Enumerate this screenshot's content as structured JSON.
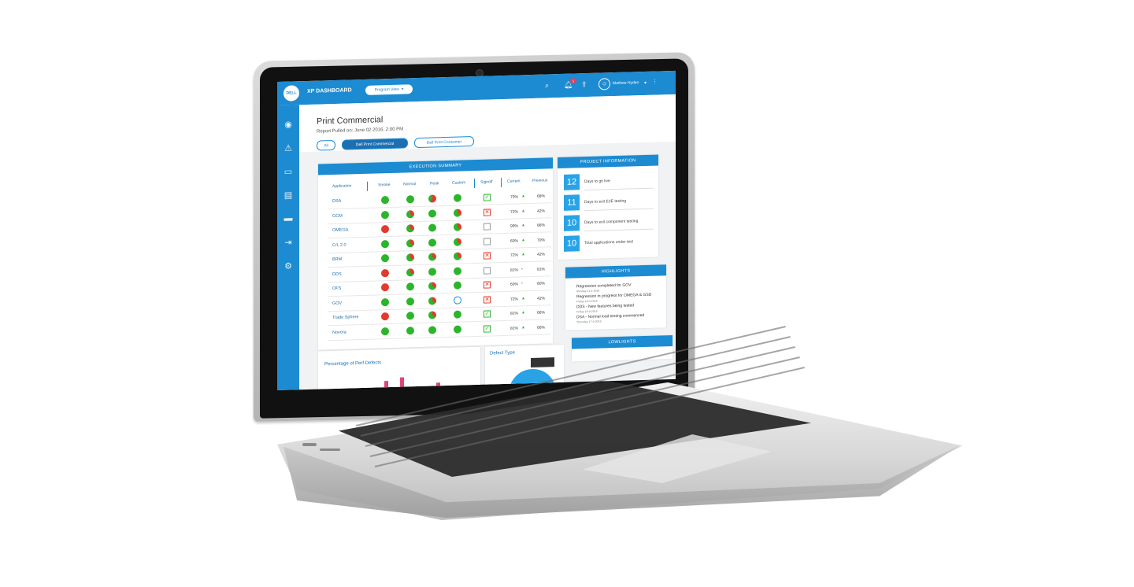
{
  "topbar": {
    "logo_text": "DELL",
    "app_title": "XP DASHBOARD",
    "view_selector": "Program View",
    "notification_count": "5",
    "user_name": "Mathew Hyden"
  },
  "sidebar": {
    "icons": [
      "eye-icon",
      "warning-icon",
      "monitor-icon",
      "document-icon",
      "card-icon",
      "logout-icon",
      "settings-icon"
    ]
  },
  "header": {
    "title": "Print Commercial",
    "report_pulled": "Report Pulled on: June 02 2016, 2:00 PM",
    "filters": [
      "All",
      "Dell Print Commercial",
      "Dell Print Consumer"
    ],
    "active_filter": "Dell Print Commercial"
  },
  "execution_summary": {
    "title": "EXECUTION SUMMARY",
    "columns": [
      "Application",
      "Smoke",
      "Normal",
      "Peak",
      "Custom",
      "Signoff",
      "Current",
      "Previous"
    ],
    "rows": [
      {
        "app": "DSA",
        "status": [
          "g",
          "g",
          "mix2",
          "g"
        ],
        "signoff": "ok",
        "current": "70%",
        "trend": "up",
        "previous": "68%"
      },
      {
        "app": "GCM",
        "status": [
          "g",
          "mix",
          "g",
          "mix"
        ],
        "signoff": "no",
        "current": "72%",
        "trend": "up",
        "previous": "42%"
      },
      {
        "app": "OMEGA",
        "status": [
          "r",
          "mix",
          "g",
          "mix"
        ],
        "signoff": "empty",
        "current": "99%",
        "trend": "up",
        "previous": "86%"
      },
      {
        "app": "C/L 2.0",
        "status": [
          "g",
          "mix",
          "g",
          "mix"
        ],
        "signoff": "empty",
        "current": "60%",
        "trend": "up",
        "previous": "70%"
      },
      {
        "app": "BRM",
        "status": [
          "g",
          "mix",
          "mix",
          "mix"
        ],
        "signoff": "no",
        "current": "72%",
        "trend": "up",
        "previous": "42%"
      },
      {
        "app": "DDS",
        "status": [
          "r",
          "mix",
          "g",
          "g"
        ],
        "signoff": "empty",
        "current": "81%",
        "trend": "flat",
        "previous": "81%"
      },
      {
        "app": "OFS",
        "status": [
          "r",
          "g",
          "mix",
          "g"
        ],
        "signoff": "no",
        "current": "60%",
        "trend": "flat",
        "previous": "60%"
      },
      {
        "app": "GOV",
        "status": [
          "g",
          "g",
          "mix",
          "empty"
        ],
        "signoff": "no",
        "current": "72%",
        "trend": "up",
        "previous": "42%"
      },
      {
        "app": "Trade Sphere",
        "status": [
          "r",
          "g",
          "mix",
          "g"
        ],
        "signoff": "ok",
        "current": "81%",
        "trend": "up",
        "previous": "66%"
      },
      {
        "app": "Novora",
        "status": [
          "g",
          "g",
          "g",
          "g"
        ],
        "signoff": "ok",
        "current": "81%",
        "trend": "up",
        "previous": "66%"
      }
    ]
  },
  "project_information": {
    "title": "PROJECT INFORMATION",
    "items": [
      {
        "value": "12",
        "label": "Days to go live"
      },
      {
        "value": "11",
        "label": "Days to exit E2E testing"
      },
      {
        "value": "10",
        "label": "Days to exit component testing"
      },
      {
        "value": "10",
        "label": "Total applications under test"
      }
    ]
  },
  "highlights": {
    "title": "HIGHLIGHTS",
    "items": [
      {
        "text": "Regression completed for GOV",
        "date": "Monday 21-4-2016"
      },
      {
        "text": "Regression in progress for OMEGA & GSD",
        "date": "Friday 18-4-2016"
      },
      {
        "text": "DDS - New features being tested",
        "date": "Friday 18-4-2016"
      },
      {
        "text": "DSA - Normal load testing commenced",
        "date": "Thursday 17-4-2016"
      }
    ]
  },
  "lowlights": {
    "title": "LOWLIGHTS"
  },
  "perf_defects": {
    "title": "Percentage of Perf Defects"
  },
  "defect_type": {
    "title": "Defect Type"
  },
  "colors": {
    "accent": "#1c8bd1",
    "green": "#2bb52b",
    "red": "#e23b2e"
  }
}
